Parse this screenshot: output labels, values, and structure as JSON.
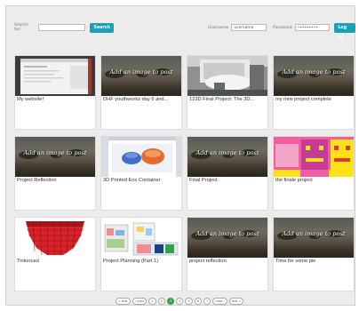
{
  "header": {
    "search_label": "Search for:",
    "search_value": "",
    "search_button": "Search",
    "username_label": "Username",
    "username_value": "username",
    "password_label": "Password",
    "password_value": "•••••••••",
    "login_button": "Log In"
  },
  "placeholder_text": "Add an image to post",
  "projects": [
    {
      "title": "My website!",
      "thumb": "screenshot"
    },
    {
      "title": "DHF youthworks day 6 and...",
      "thumb": "placeholder"
    },
    {
      "title": "123D Final Project: The 3D...",
      "thumb": "photo-3d-print"
    },
    {
      "title": "my new project complete",
      "thumb": "placeholder"
    },
    {
      "title": "Project Reflection",
      "thumb": "placeholder"
    },
    {
      "title": "3D Printed Eos Container",
      "thumb": "3d-model-render"
    },
    {
      "title": "Final Project",
      "thumb": "placeholder"
    },
    {
      "title": "the finale project",
      "thumb": "pixel-smileys"
    },
    {
      "title": "Tinkercad",
      "thumb": "tinkercad-red-model"
    },
    {
      "title": "Project Planning (Part 1)",
      "thumb": "floor-plan"
    },
    {
      "title": "project reflection",
      "thumb": "placeholder"
    },
    {
      "title": "Time for some pie",
      "thumb": "placeholder"
    }
  ],
  "pager": {
    "items": [
      "« first",
      "‹ prev",
      "1",
      "2",
      "3",
      "4",
      "5",
      "6",
      "7",
      "next ›",
      "last »"
    ],
    "active": "3"
  },
  "colors": {
    "accent_button": "#1aa1b5",
    "pager_active": "#38a24d",
    "frame_bg": "#ececec"
  }
}
